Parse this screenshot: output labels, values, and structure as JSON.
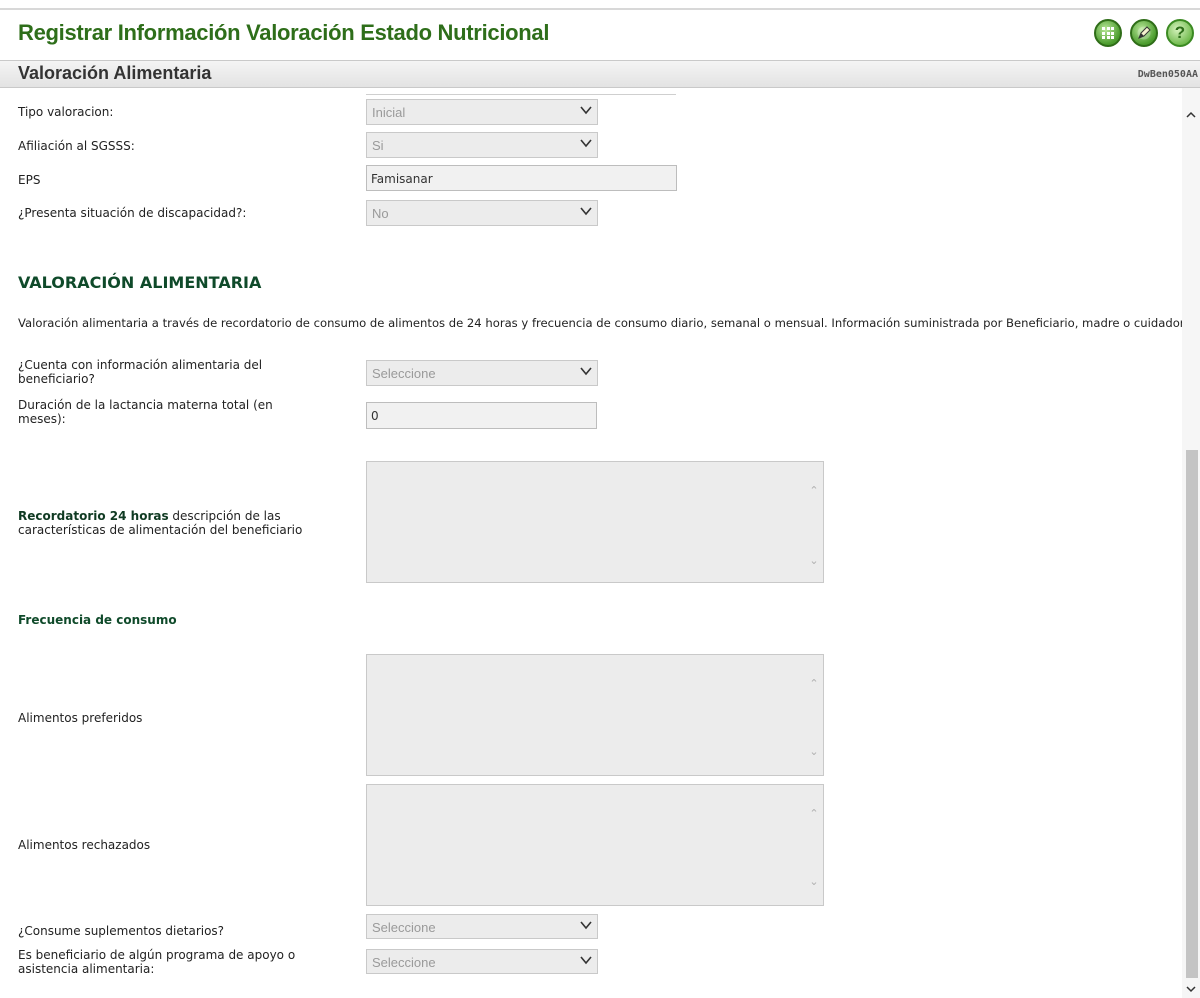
{
  "header": {
    "title": "Registrar Información Valoración Estado Nutricional",
    "icons": [
      "calculator-icon",
      "edit-icon",
      "help-icon"
    ],
    "help_glyph": "?"
  },
  "section": {
    "title": "Valoración Alimentaria",
    "code": "DwBen050AA"
  },
  "fields": {
    "tipo_valoracion": {
      "label": "Tipo valoracion:",
      "value": "Inicial"
    },
    "afiliacion": {
      "label": "Afiliación al SGSSS:",
      "value": "Si"
    },
    "eps": {
      "label": "EPS",
      "value": "Famisanar"
    },
    "discapacidad": {
      "label": "¿Presenta situación de discapacidad?:",
      "value": "No"
    }
  },
  "valoracion": {
    "heading": "VALORACIÓN ALIMENTARIA",
    "description": "Valoración alimentaria a través de recordatorio de consumo de alimentos de 24 horas y frecuencia de consumo diario, semanal o mensual. Información suministrada por Beneficiario, madre o cuidador.",
    "info_alimentaria": {
      "label_1": "¿Cuenta con información alimentaria del",
      "label_2": "beneficiario?",
      "value": "Seleccione"
    },
    "lactancia": {
      "label_1": "Duración de la lactancia materna total (en",
      "label_2": "meses):",
      "value": "0"
    },
    "recordatorio": {
      "label_bold": "Recordatorio 24 horas",
      "label_rest": " descripción de las",
      "label_2": "características de alimentación del beneficiario"
    },
    "frecuencia_heading": "Frecuencia de consumo",
    "preferidos": {
      "label": "Alimentos preferidos"
    },
    "rechazados": {
      "label": "Alimentos rechazados"
    },
    "suplementos": {
      "label": "¿Consume suplementos dietarios?",
      "value": "Seleccione"
    },
    "programa": {
      "label_1": "Es beneficiario de algún programa de apoyo o",
      "label_2": "asistencia alimentaria:",
      "value": "Seleccione"
    }
  },
  "colors": {
    "title": "#2e6e1a",
    "heading": "#0f4a2a",
    "field_bg": "#ececec"
  }
}
